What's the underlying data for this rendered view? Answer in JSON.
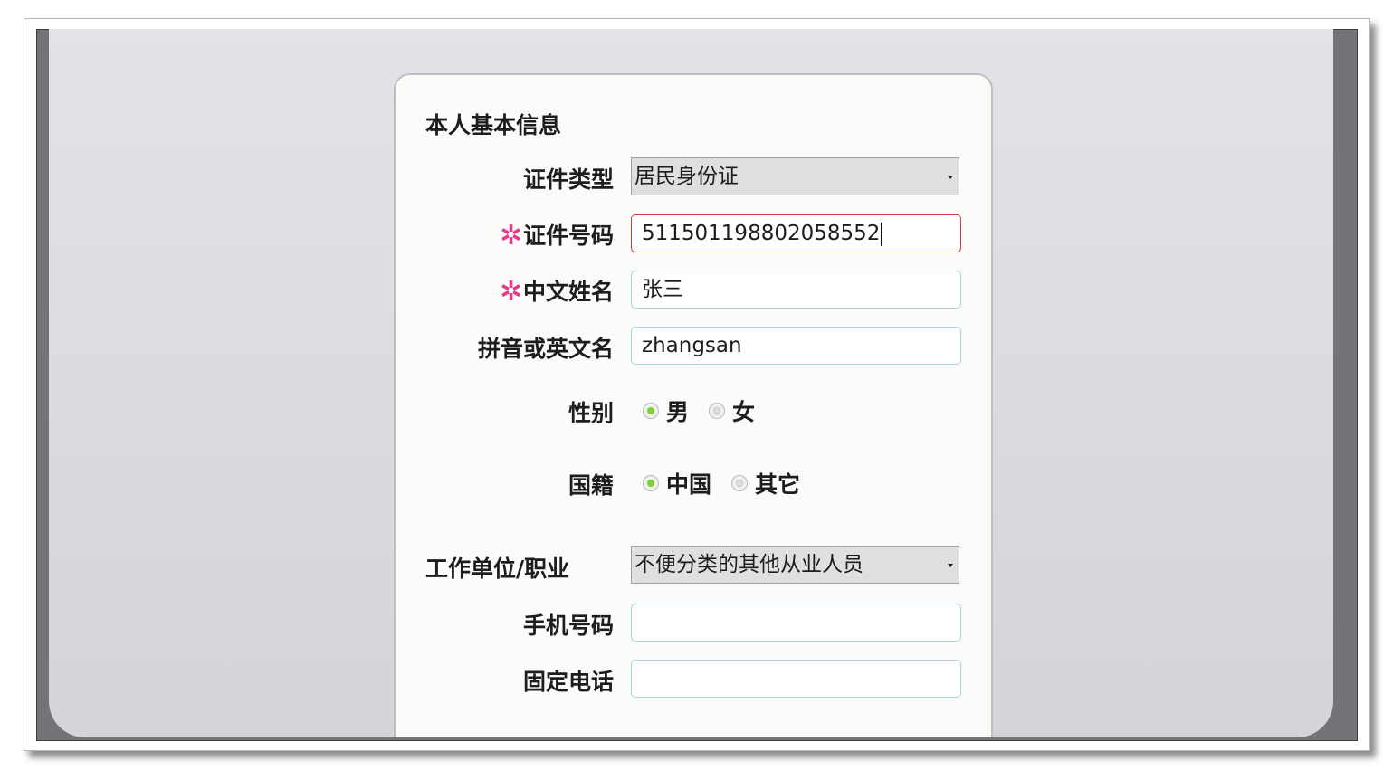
{
  "form": {
    "section_title": "本人基本信息",
    "required_mark": "✲",
    "id_type": {
      "label": "证件类型",
      "value": "居民身份证"
    },
    "id_number": {
      "label": "证件号码",
      "value": "511501198802058552"
    },
    "chinese_name": {
      "label": "中文姓名",
      "value": "张三"
    },
    "pinyin_name": {
      "label": "拼音或英文名",
      "value": "zhangsan"
    },
    "gender": {
      "label": "性别",
      "options": [
        "男",
        "女"
      ],
      "selected": "男"
    },
    "nationality": {
      "label": "国籍",
      "options": [
        "中国",
        "其它"
      ],
      "selected": "中国"
    },
    "occupation": {
      "label": "工作单位/职业",
      "value": "不便分类的其他从业人员"
    },
    "mobile": {
      "label": "手机号码",
      "value": ""
    },
    "landline": {
      "label": "固定电话",
      "value": ""
    }
  },
  "colors": {
    "required": "#e33a88",
    "radio_selected": "#7bd12f",
    "error_border": "#d23a3a",
    "input_border": "#a7d2e1"
  }
}
